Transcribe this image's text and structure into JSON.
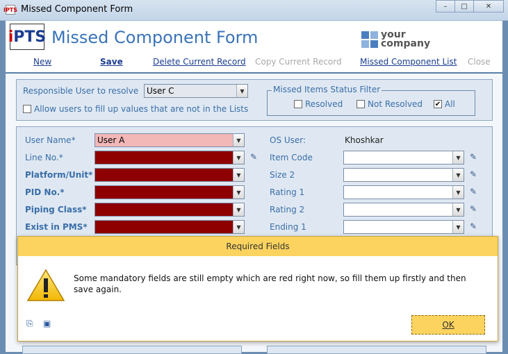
{
  "window": {
    "title": "Missed Component Form",
    "app_icon_text": "IPTS",
    "minimize_label": "–",
    "maximize_label": "□",
    "close_label": "✕"
  },
  "header": {
    "logo_i": "i",
    "logo_rest": "PTS",
    "form_title": "Missed Component Form",
    "company_line1": "your",
    "company_line2": "company"
  },
  "toolbar": {
    "new": "New",
    "save": "Save",
    "delete": "Delete Current Record",
    "copy": "Copy Current Record",
    "list": "Missed Component List",
    "close": "Close"
  },
  "filter_panel": {
    "responsible_label": "Responsible User to resolve",
    "responsible_value": "User C",
    "allow_label": "Allow users to fill up values that are not in the Lists",
    "allow_checked": false,
    "status_title": "Missed Items Status Filter",
    "resolved_label": "Resolved",
    "resolved_checked": false,
    "not_resolved_label": "Not Resolved",
    "not_resolved_checked": false,
    "all_label": "All",
    "all_checked": true
  },
  "form": {
    "left_fields": [
      {
        "label": "User Name*",
        "value": "User A",
        "state": "pink",
        "bold": false
      },
      {
        "label": "Line No.*",
        "value": "",
        "state": "red",
        "bold": false
      },
      {
        "label": "Platform/Unit*",
        "value": "",
        "state": "red",
        "bold": true
      },
      {
        "label": "PID No.*",
        "value": "",
        "state": "red",
        "bold": true
      },
      {
        "label": "Piping Class*",
        "value": "",
        "state": "red",
        "bold": true
      },
      {
        "label": "Exist in PMS*",
        "value": "",
        "state": "red",
        "bold": true
      }
    ],
    "os_user_label": "OS User:",
    "os_user_value": "Khoshkar",
    "right_fields": [
      {
        "label": "Item Code",
        "value": ""
      },
      {
        "label": "Size 2",
        "value": ""
      },
      {
        "label": "Rating 1",
        "value": ""
      },
      {
        "label": "Rating 2",
        "value": ""
      },
      {
        "label": "Ending 1",
        "value": ""
      }
    ]
  },
  "dialog": {
    "title": "Required Fields",
    "message": "Some mandatory fields are still empty which are red right now, so fill them up firstly and then save again.",
    "ok_label": "OK",
    "icon_copy": "copy-icon",
    "icon_save": "save-icon"
  }
}
